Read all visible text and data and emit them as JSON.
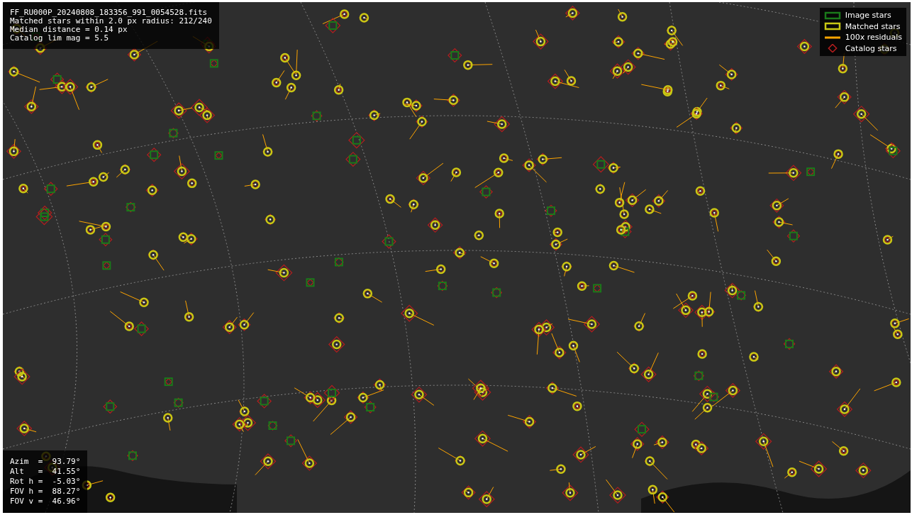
{
  "info_box": {
    "lines": [
      "FF_RU000P_20240808_183356_991_0054528.fits",
      "Matched stars within 2.0 px radius: 212/240",
      "Median distance = 0.14 px",
      "Catalog lim mag = 5.5"
    ]
  },
  "legend": [
    {
      "kind": "image",
      "label": "Image stars",
      "color": "#1a7a1a"
    },
    {
      "kind": "matched",
      "label": "Matched stars",
      "color": "#c8c814"
    },
    {
      "kind": "residual",
      "label": "100x residuals",
      "color": "#ffa500"
    },
    {
      "kind": "catalog",
      "label": "Catalog stars",
      "color": "#b41e1e"
    }
  ],
  "pointing_box": {
    "lines": [
      "Azim  =  93.79°",
      "Alt   =  41.55°",
      "Rot h =  -5.03°",
      "FOV h =  88.27°",
      "FOV v =  46.96°"
    ]
  }
}
